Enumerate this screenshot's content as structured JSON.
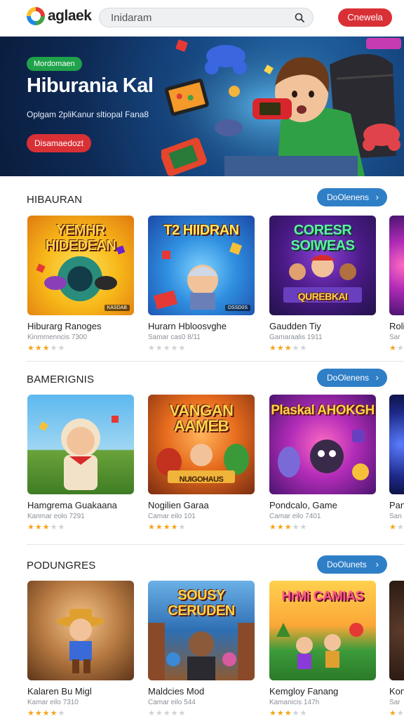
{
  "header": {
    "logo_text": "aglaek",
    "search_placeholder": "Inidaram",
    "action_label": "Cnewela"
  },
  "hero": {
    "badge": "Mordomaen",
    "title": "Hiburania Kal",
    "subtitle": "Oplgam 2pliKanur sltiopal Fana8",
    "button_label": "Disamaedozt"
  },
  "sections": [
    {
      "title": "HIBAURAN",
      "button_label": "DoOlenens",
      "cards": [
        {
          "thumb_text": "YEMHR HIDEDEAN",
          "tag": "KASDAB",
          "name": "Hiburarg Ranoges",
          "meta": "Kinmmenncis 7300",
          "rating": 3
        },
        {
          "thumb_text": "T2 HIIDRAN",
          "tag": "DSSD0S",
          "name": "Hurarn Hbloosvghe",
          "meta": "Samar cas0 8/11",
          "rating": 0
        },
        {
          "thumb_text": "CORESR SOIWEAS",
          "tag": "QUREBKAI",
          "name": "Gaudden Tiy",
          "meta": "Gamaraalis 1911",
          "rating": 3
        },
        {
          "thumb_text": "",
          "tag": "",
          "name": "Roli",
          "meta": "Sar",
          "rating": 1
        }
      ]
    },
    {
      "title": "BAMERIGNIS",
      "button_label": "DoOlenens",
      "cards": [
        {
          "thumb_text": "",
          "tag": "",
          "name": "Hamgrema Guakaana",
          "meta": "Kanmar eolo 7291",
          "rating": 3
        },
        {
          "thumb_text": "VANGAN AAMEB",
          "tag": "NUIGOHAUS",
          "name": "Nogilien Garaa",
          "meta": "Camar eilo 101",
          "rating": 4
        },
        {
          "thumb_text": "Plaskal AHOKGH",
          "tag": "",
          "name": "Pondcalo, Game",
          "meta": "Camar eilo 7401",
          "rating": 3
        },
        {
          "thumb_text": "",
          "tag": "",
          "name": "Pan",
          "meta": "San",
          "rating": 1
        }
      ]
    },
    {
      "title": "PODUNGRES",
      "button_label": "DoOlunets",
      "cards": [
        {
          "thumb_text": "",
          "tag": "",
          "name": "Kalaren Bu Migl",
          "meta": "Kamar eilo 7310",
          "rating": 4
        },
        {
          "thumb_text": "SOUSY CERUDEN",
          "tag": "",
          "name": "Maldcies Mod",
          "meta": "Camar eilo 544",
          "rating": 0
        },
        {
          "thumb_text": "HrMi CAMIAS",
          "tag": "",
          "name": "Kemgloy Fanang",
          "meta": "Kamanicis 147h",
          "rating": 3
        },
        {
          "thumb_text": "",
          "tag": "",
          "name": "Kon",
          "meta": "Sar",
          "rating": 1
        }
      ]
    }
  ],
  "colors": {
    "accent_red": "#d93036",
    "accent_blue": "#2f7fc7",
    "badge_green": "#1fa24a",
    "star": "#f4a51c"
  }
}
